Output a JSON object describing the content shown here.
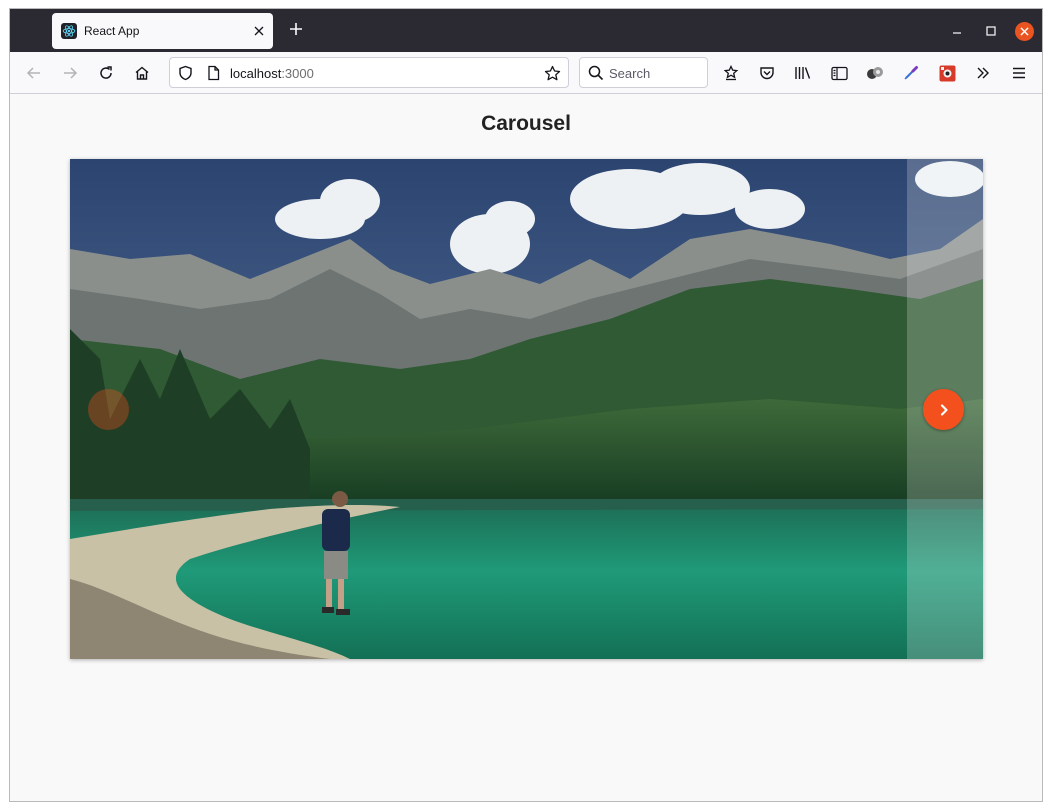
{
  "browser": {
    "tab": {
      "title": "React App",
      "favicon": "react-logo-icon",
      "close_icon": "close-icon"
    },
    "new_tab_icon": "plus-icon",
    "window_controls": [
      "minimize-icon",
      "maximize-icon",
      "close-icon"
    ],
    "toolbar": {
      "back_icon": "arrow-left-icon",
      "forward_icon": "arrow-right-icon",
      "reload_icon": "reload-icon",
      "home_icon": "home-icon",
      "url_host": "localhost",
      "url_port": ":3000",
      "search_placeholder": "Search",
      "right_icons": [
        "pocket-save-icon",
        "pocket-icon",
        "library-icon",
        "sidebar-icon",
        "extension-icon",
        "eyedropper-icon",
        "addon-icon",
        "overflow-icon",
        "menu-icon"
      ]
    }
  },
  "page": {
    "title": "Carousel",
    "carousel": {
      "slide_image": "mountain-lake-landscape",
      "next_icon": "chevron-right-icon",
      "accent": "#f4501e"
    }
  }
}
